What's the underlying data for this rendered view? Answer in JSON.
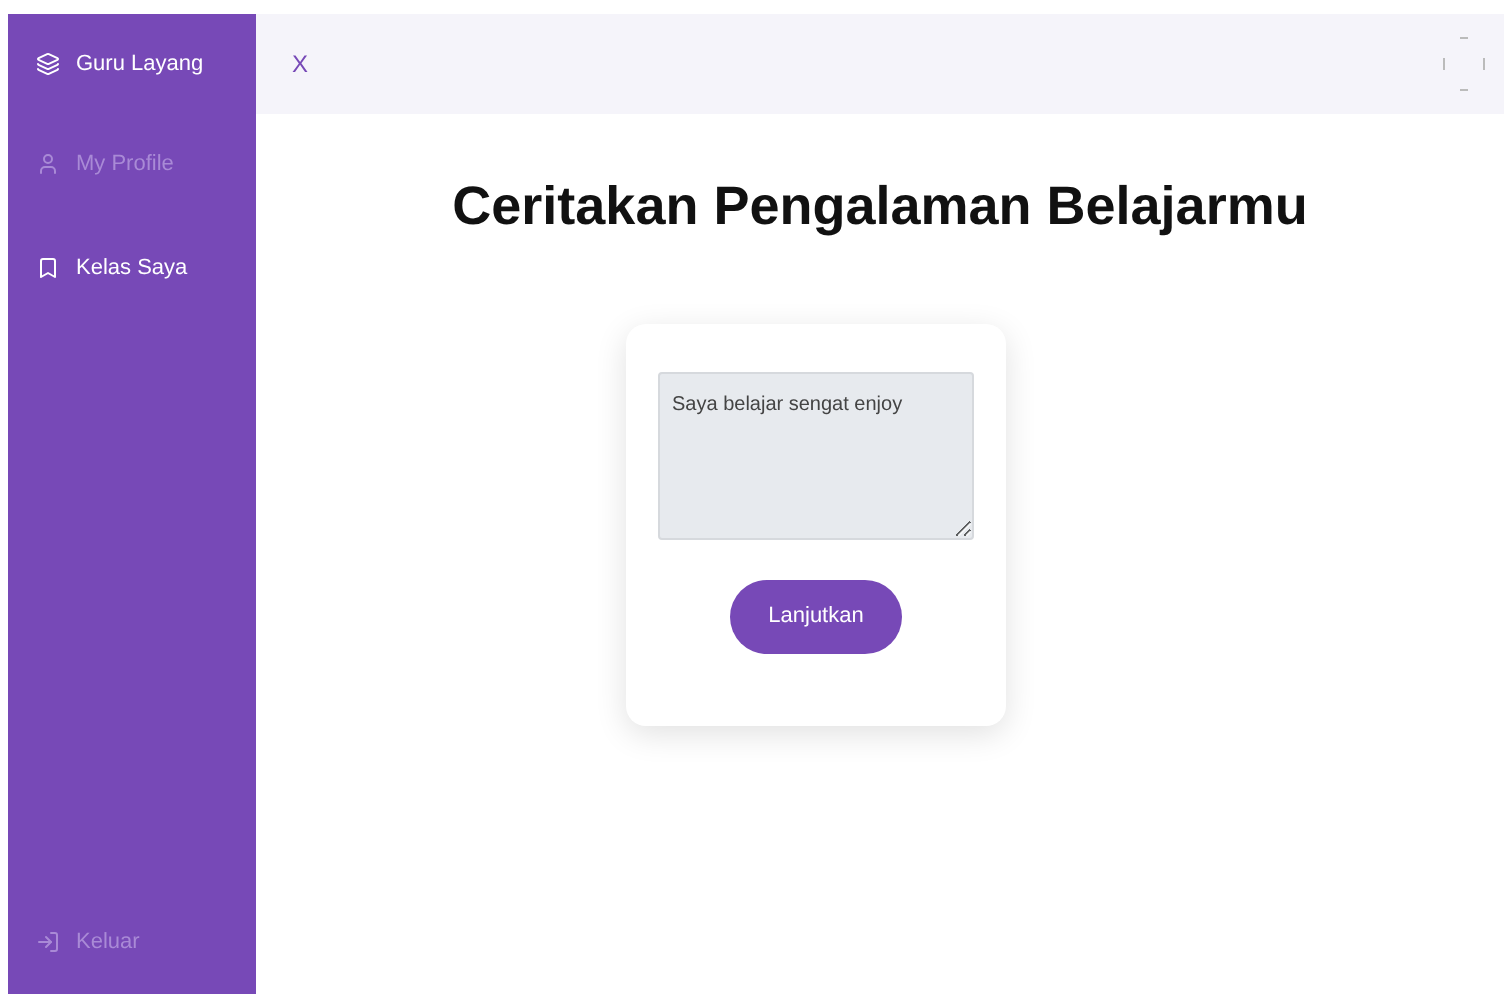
{
  "sidebar": {
    "brand": "Guru Layang",
    "items": [
      {
        "label": "My Profile",
        "selected": false
      },
      {
        "label": "Kelas Saya",
        "selected": true
      }
    ],
    "logout": "Keluar"
  },
  "header": {
    "close": "X"
  },
  "title": "Ceritakan Pengalaman Belajarmu",
  "form": {
    "value": "Saya belajar sengat enjoy",
    "button": "Lanjutkan"
  }
}
